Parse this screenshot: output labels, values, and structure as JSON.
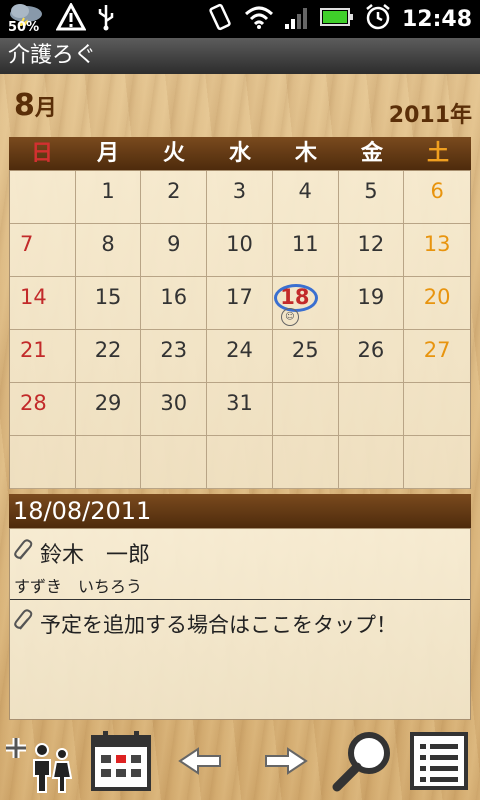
{
  "status_bar": {
    "battery_text": "50%",
    "time": "12:48"
  },
  "app": {
    "title": "介護ろぐ"
  },
  "calendar": {
    "month_num": "8",
    "month_suffix": "月",
    "year": "2011年",
    "weekdays": [
      "日",
      "月",
      "火",
      "水",
      "木",
      "金",
      "土"
    ],
    "weeks": [
      [
        "",
        "1",
        "2",
        "3",
        "4",
        "5",
        "6"
      ],
      [
        "7",
        "8",
        "9",
        "10",
        "11",
        "12",
        "13"
      ],
      [
        "14",
        "15",
        "16",
        "17",
        "18",
        "19",
        "20"
      ],
      [
        "21",
        "22",
        "23",
        "24",
        "25",
        "26",
        "27"
      ],
      [
        "28",
        "29",
        "30",
        "31",
        "",
        "",
        ""
      ],
      [
        "",
        "",
        "",
        "",
        "",
        "",
        ""
      ]
    ],
    "today": "18"
  },
  "detail": {
    "date": "18/08/2011",
    "person_name": "鈴木　一郎",
    "person_kana": "すずき　いちろう",
    "add_hint": "予定を追加する場合はここをタップ！"
  },
  "toolbar": {
    "icons": [
      "add-person-icon",
      "calendar-icon",
      "prev-arrow-icon",
      "next-arrow-icon",
      "search-icon",
      "list-icon"
    ]
  },
  "colors": {
    "sunday": "#c22a2a",
    "saturday": "#e8940e",
    "today_ring": "#3a6fd0",
    "header_wood": "#5a2e08"
  }
}
